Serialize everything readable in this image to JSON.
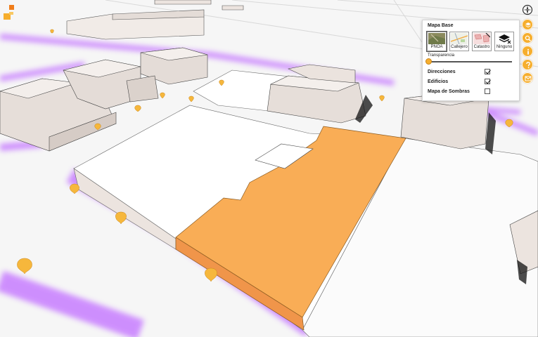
{
  "map": {
    "highlight_color": "#f9ad56",
    "route_color": "#c77dff",
    "marker_color": "#f6b73c"
  },
  "basemap_panel": {
    "title": "Mapa Base",
    "options": [
      {
        "label": "PNOA",
        "icon": "aerial-thumbnail-icon",
        "selected": true
      },
      {
        "label": "Callejero",
        "icon": "street-map-thumbnail-icon",
        "selected": false
      },
      {
        "label": "Catastro",
        "icon": "cadastre-thumbnail-icon",
        "selected": false
      },
      {
        "label": "Ninguno",
        "icon": "layers-none-icon",
        "selected": false
      }
    ],
    "transparency_label": "Transparencia",
    "transparency_value": 0
  },
  "layers": [
    {
      "label": "Direcciones",
      "checked": true
    },
    {
      "label": "Edificios",
      "checked": true
    },
    {
      "label": "Mapa de Sombras",
      "checked": false
    }
  ],
  "toolbar": [
    {
      "icon": "layers-icon"
    },
    {
      "icon": "search-icon"
    },
    {
      "icon": "info-icon"
    },
    {
      "icon": "help-icon"
    },
    {
      "icon": "mail-icon"
    }
  ],
  "compass": {
    "icon": "compass-icon"
  }
}
